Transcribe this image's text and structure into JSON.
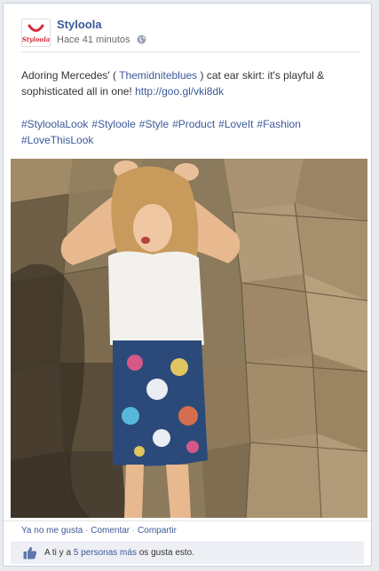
{
  "post": {
    "page_name": "Styloola",
    "logo_text": "Styloola",
    "timestamp": "Hace 41 minutos",
    "text_part1": "Adoring Mercedes' ( ",
    "mention": "Themidniteblues",
    "text_part2": " ) cat ear skirt: it's playful & sophisticated all in one! ",
    "url": "http://goo.gl/vki8dk",
    "hashtags": [
      "#StyloolaLook",
      "#Styloole",
      "#Style",
      "#Product",
      "#LoveIt",
      "#Fashion",
      "#LoveThisLook"
    ]
  },
  "actions": {
    "unlike": "Ya no me gusta",
    "sep1": "·",
    "comment": "Comentar",
    "sep2": "·",
    "share": "Compartir"
  },
  "likes": {
    "prefix": "A ti y a ",
    "people_link": "5 personas más",
    "suffix": " os gusta esto."
  },
  "colors": {
    "link": "#3b5998",
    "brand_red": "#d8293b"
  },
  "icons": {
    "globe": "globe-icon",
    "like": "thumbs-up-icon"
  }
}
